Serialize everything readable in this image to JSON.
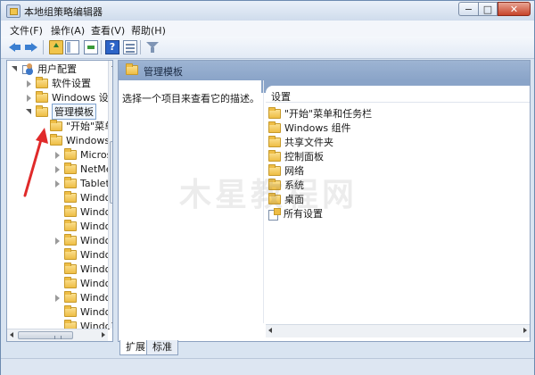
{
  "window": {
    "title": "本地组策略编辑器",
    "min": "−",
    "max": "□",
    "close": "✕"
  },
  "menu": [
    "文件(F)",
    "操作(A)",
    "查看(V)",
    "帮助(H)"
  ],
  "toolbar": {
    "back": "back-icon",
    "forward": "forward-icon",
    "up": "up-folder-icon",
    "show_hide": "show-hide-tree-icon",
    "export": "export-list-icon",
    "help": "?",
    "properties": "properties-icon",
    "filter": "filter-icon"
  },
  "tree": {
    "items": [
      {
        "label": "用户配置"
      },
      {
        "label": "软件设置"
      },
      {
        "label": "Windows 设置"
      },
      {
        "label": "管理模板"
      },
      {
        "label": "\"开始\"菜单"
      },
      {
        "label": "Windows 组件"
      },
      {
        "label": "Microsoft"
      },
      {
        "label": "NetMeeting"
      },
      {
        "label": "Tablet PC"
      },
      {
        "label": "Windows"
      },
      {
        "label": "Windows"
      },
      {
        "label": "Windows"
      },
      {
        "label": "Windows"
      },
      {
        "label": "Windows"
      },
      {
        "label": "Windows"
      },
      {
        "label": "Windows"
      },
      {
        "label": "Windows"
      },
      {
        "label": "Windows"
      },
      {
        "label": "Windows"
      }
    ]
  },
  "right": {
    "header_title": "管理模板",
    "description": "选择一个项目来查看它的描述。",
    "column_header": "设置",
    "items": [
      {
        "label": "\"开始\"菜单和任务栏"
      },
      {
        "label": "Windows 组件"
      },
      {
        "label": "共享文件夹"
      },
      {
        "label": "控制面板"
      },
      {
        "label": "网络"
      },
      {
        "label": "系统"
      },
      {
        "label": "桌面"
      },
      {
        "label": "所有设置"
      }
    ]
  },
  "tabs": [
    "扩展",
    "标准"
  ],
  "watermark": "木星教程网",
  "colors": {
    "accent": "#3b7fd1",
    "header": "#8aa4c8",
    "annotation": "#e02a2a"
  }
}
